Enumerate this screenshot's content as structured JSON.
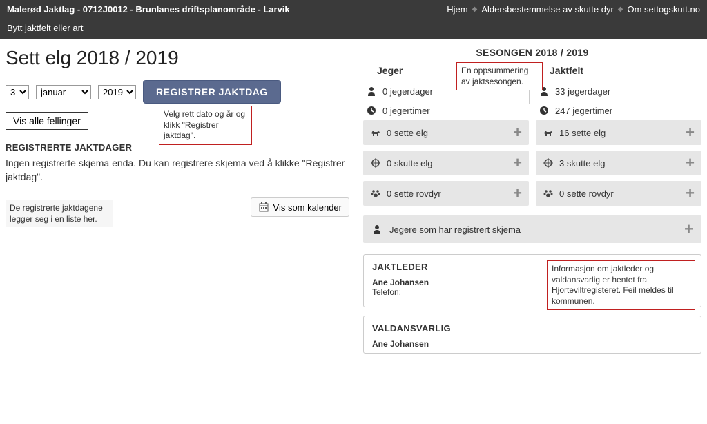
{
  "topbar": {
    "title": "Malerød Jaktlag - 0712J0012 - Brunlanes driftsplanområde - Larvik",
    "nav": {
      "home": "Hjem",
      "age": "Aldersbestemmelse av skutte dyr",
      "about": "Om settogskutt.no"
    },
    "switch": "Bytt jaktfelt eller art"
  },
  "page": {
    "title": "Sett elg 2018 / 2019",
    "day": "3",
    "month": "januar",
    "year": "2019",
    "register_button": "REGISTRER JAKTDAG",
    "show_all": "Vis alle fellinger",
    "section_title": "REGISTRERTE JAKTDAGER",
    "empty_text": "Ingen registrerte skjema enda. Du kan registrere skjema ved å klikke \"Registrer jaktdag\".",
    "calendar_button": "Vis som kalender"
  },
  "annotations": {
    "date_hint": "Velg rett dato og år og klikk \"Registrer jaktdag\".",
    "list_hint": "De registrerte jaktdagene legger seg i en liste her.",
    "summary_hint": "En oppsummering av jaktsesongen.",
    "leader_hint": "Informasjon om jaktleder og valdansvarlig  er hentet fra Hjorteviltregisteret. Feil meldes til kommunen."
  },
  "season": {
    "title": "SESONGEN 2018 / 2019",
    "jeger": {
      "title": "Jeger",
      "jegerdager": "0 jegerdager",
      "jegertimer": "0 jegertimer",
      "sette_elg": "0 sette elg",
      "skutte_elg": "0 skutte elg",
      "sette_rovdyr": "0 sette rovdyr"
    },
    "jaktfelt": {
      "title": "Jaktfelt",
      "jegerdager": "33 jegerdager",
      "jegertimer": "247 jegertimer",
      "sette_elg": "16 sette elg",
      "skutte_elg": "3 skutte elg",
      "sette_rovdyr": "0 sette rovdyr"
    },
    "jegere_row": "Jegere som har registrert skjema"
  },
  "leader": {
    "title": "JAKTLEDER",
    "name": "Ane Johansen",
    "phone_label": "Telefon:"
  },
  "vald": {
    "title": "VALDANSVARLIG",
    "name": "Ane Johansen"
  }
}
